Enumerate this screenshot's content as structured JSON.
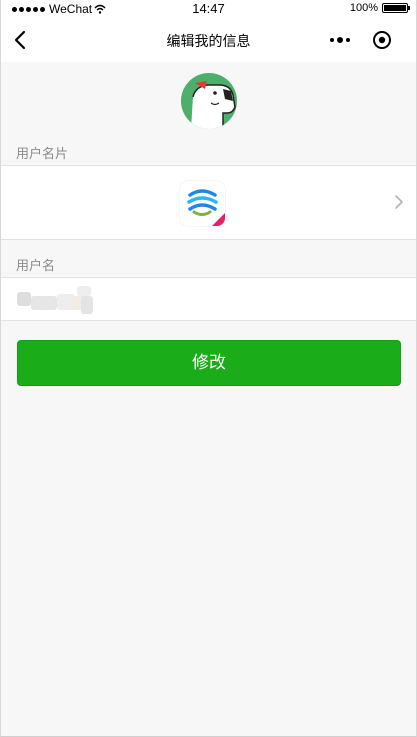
{
  "status_bar": {
    "carrier": "WeChat",
    "time": "14:47",
    "battery": "100%"
  },
  "nav": {
    "title": "编辑我的信息"
  },
  "sections": {
    "card_label": "用户名片",
    "username_label": "用户名"
  },
  "form": {
    "submit_label": "修改"
  },
  "colors": {
    "accent": "#1aad19",
    "background": "#f7f7f7"
  },
  "icons": [
    "back-arrow-icon",
    "more-dots-icon",
    "close-circle-icon",
    "chevron-right-icon",
    "wifi-icon",
    "battery-icon"
  ]
}
